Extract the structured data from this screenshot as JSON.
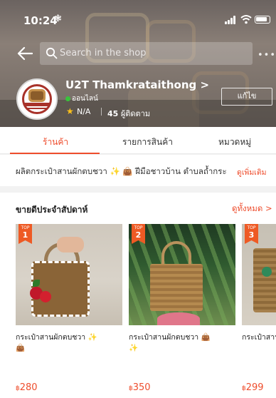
{
  "status_bar": {
    "time": "10:24",
    "gear_glyph": "❃",
    "icons": [
      "signal-icon",
      "wifi-icon",
      "battery-icon"
    ]
  },
  "header": {
    "back_icon": "arrow-left-icon",
    "search_placeholder": "Search in the shop",
    "more_glyph": "•••",
    "shop_name": "U2T Thamkrataithong >",
    "online_status": "ออนไลน์",
    "rating": "N/A",
    "followers_count": "45",
    "followers_label": "ผู้ติดตาม",
    "edit_button": "แก้ไข"
  },
  "tabs": [
    {
      "label": "ร้านค้า",
      "active": true
    },
    {
      "label": "รายการสินค้า",
      "active": false
    },
    {
      "label": "หมวดหมู่",
      "active": false
    }
  ],
  "description": {
    "text": "ผลิตกระเป๋าสานผักตบชวา ✨ 👜 ฝีมือชาวบ้าน ตำบลถ้ำกระ",
    "more_link": "ดูเพิ่มเติม"
  },
  "best_sellers": {
    "title": "ขายดีประจำสัปดาห์",
    "see_all": "ดูทั้งหมด >",
    "products": [
      {
        "rank_label": "TOP",
        "rank": "1",
        "name": "กระเป๋าสานผักตบชวา ✨ 👜",
        "currency": "฿",
        "price": "280"
      },
      {
        "rank_label": "TOP",
        "rank": "2",
        "name": "กระเป๋าสานผักตบชวา 👜 ✨",
        "currency": "฿",
        "price": "350"
      },
      {
        "rank_label": "TOP",
        "rank": "3",
        "name": "กระเป๋าสาน ✨",
        "currency": "฿",
        "price": "299"
      }
    ]
  },
  "colors": {
    "accent": "#ee4d2d",
    "online": "#39c23c",
    "star": "#ffc21a"
  }
}
